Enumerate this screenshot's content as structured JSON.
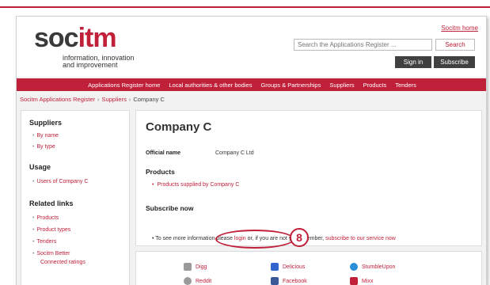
{
  "header": {
    "logo_soc": "soc",
    "logo_itm": "itm",
    "tagline_line1": "information, innovation",
    "tagline_line2": "and improvement",
    "home_link": "Socitm home",
    "search_placeholder": "Search the Applications Register ...",
    "search_button": "Search",
    "signin_button": "Sign in",
    "subscribe_button": "Subscribe"
  },
  "nav": {
    "items": [
      "Applications Register home",
      "Local authorities & other bodies",
      "Groups & Partnerships",
      "Suppliers",
      "Products",
      "Tenders"
    ]
  },
  "breadcrumb": {
    "items": [
      "Socitm Applications Register",
      "Suppliers",
      "Company C"
    ],
    "separator": "›"
  },
  "sidebar": {
    "suppliers_heading": "Suppliers",
    "suppliers_links": [
      "By name",
      "By type"
    ],
    "usage_heading": "Usage",
    "usage_links": [
      "Users of Company C"
    ],
    "related_heading": "Related links",
    "related_links": [
      "Products",
      "Product types",
      "Tenders",
      "Socitm Better",
      "Connected ratings"
    ]
  },
  "main": {
    "title": "Company C",
    "official_name_label": "Official name",
    "official_name_value": "Company C Ltd",
    "products_heading": "Products",
    "products_link": "Products supplied by Company C",
    "subscribe_heading": "Subscribe now",
    "subscribe_text_a": "To see more information please ",
    "subscribe_login": "login",
    "subscribe_text_b": " or, if you are not yet a member, ",
    "subscribe_link": "subscribe to our service now",
    "annotation_number": "8"
  },
  "social": {
    "items": [
      {
        "label": "Digg",
        "icon": "digg-icon",
        "color": "#9a9a9a"
      },
      {
        "label": "Delicious",
        "icon": "delicious-icon",
        "color": "#3366cc"
      },
      {
        "label": "StumbleUpon",
        "icon": "stumbleupon-icon",
        "color": "#2a8fd8"
      },
      {
        "label": "Reddit",
        "icon": "reddit-icon",
        "color": "#9a9a9a"
      },
      {
        "label": "Facebook",
        "icon": "facebook-icon",
        "color": "#3b5998"
      },
      {
        "label": "Mixx",
        "icon": "mixx-icon",
        "color": "#c0203a"
      }
    ]
  },
  "colors": {
    "brand": "#c0203a",
    "dark_button": "#404040"
  }
}
